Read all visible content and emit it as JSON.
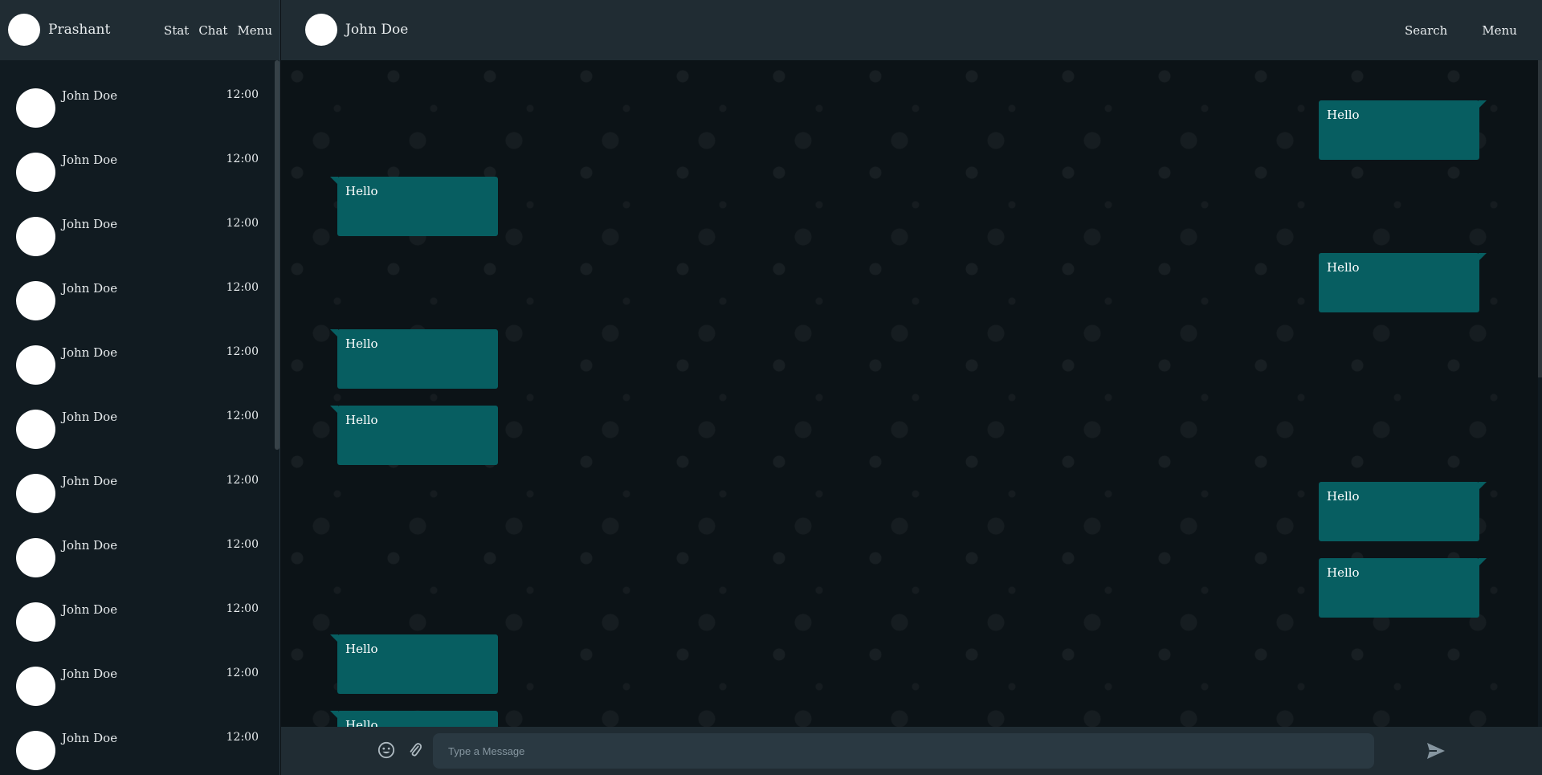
{
  "sidebar": {
    "user_name": "Prashant",
    "nav": [
      "Stat",
      "Chat",
      "Menu"
    ],
    "chats": [
      {
        "name": "John Doe",
        "time": "12:00"
      },
      {
        "name": "John Doe",
        "time": "12:00"
      },
      {
        "name": "John Doe",
        "time": "12:00"
      },
      {
        "name": "John Doe",
        "time": "12:00"
      },
      {
        "name": "John Doe",
        "time": "12:00"
      },
      {
        "name": "John Doe",
        "time": "12:00"
      },
      {
        "name": "John Doe",
        "time": "12:00"
      },
      {
        "name": "John Doe",
        "time": "12:00"
      },
      {
        "name": "John Doe",
        "time": "12:00"
      },
      {
        "name": "John Doe",
        "time": "12:00"
      },
      {
        "name": "John Doe",
        "time": "12:00"
      }
    ]
  },
  "conversation": {
    "contact_name": "John Doe",
    "nav": [
      "Search",
      "Menu"
    ],
    "messages": [
      {
        "direction": "outgoing",
        "text": "Hello"
      },
      {
        "direction": "incoming",
        "text": "Hello"
      },
      {
        "direction": "outgoing",
        "text": "Hello"
      },
      {
        "direction": "incoming",
        "text": "Hello"
      },
      {
        "direction": "incoming",
        "text": "Hello"
      },
      {
        "direction": "outgoing",
        "text": "Hello"
      },
      {
        "direction": "outgoing",
        "text": "Hello"
      },
      {
        "direction": "incoming",
        "text": "Hello"
      },
      {
        "direction": "incoming",
        "text": "Hello"
      }
    ]
  },
  "composer": {
    "placeholder": "Type a Message",
    "icons": [
      "emoji-icon",
      "paperclip-icon",
      "send-icon"
    ]
  },
  "colors": {
    "panel": "#202c33",
    "sidebar": "#111b21",
    "bubble": "#075e61",
    "text": "#e9edef"
  }
}
